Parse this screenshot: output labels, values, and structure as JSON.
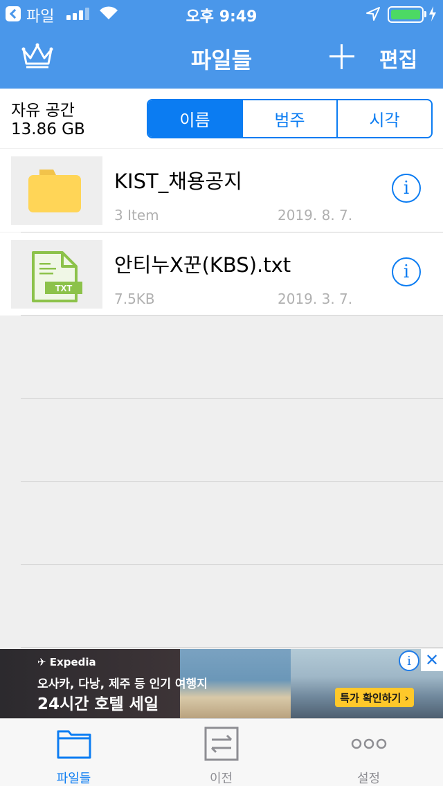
{
  "status_bar": {
    "back_app": "파일",
    "time": "오후 9:49"
  },
  "nav": {
    "title": "파일들",
    "edit_label": "편집"
  },
  "storage": {
    "label": "자유 공간",
    "value": "13.86 GB"
  },
  "sort_segments": [
    "이름",
    "범주",
    "시각"
  ],
  "files": [
    {
      "name": "KIST_채용공지",
      "meta": "3 Item",
      "date": "2019. 8. 7.",
      "icon": "folder-icon"
    },
    {
      "name": "안티누X꾼(KBS).txt",
      "meta": "7.5KB",
      "date": "2019. 3. 7.",
      "icon": "txt-file-icon"
    }
  ],
  "ad": {
    "brand": "Expedia",
    "headline": "오사카, 다낭, 제주 등 인기 여행지",
    "subline": "24시간 호텔 세일",
    "cta": "특가 확인하기 ›"
  },
  "tabs": [
    {
      "label": "파일들",
      "icon": "folder-icon",
      "active": true
    },
    {
      "label": "이전",
      "icon": "transfer-icon",
      "active": false
    },
    {
      "label": "설정",
      "icon": "more-icon",
      "active": false
    }
  ],
  "colors": {
    "nav_bar": "#4a97ea",
    "accent": "#0b7cf2",
    "folder": "#ffd557",
    "txt_file": "#8cc24a",
    "ad_cta": "#ffc82a"
  },
  "txt_badge": "TXT"
}
